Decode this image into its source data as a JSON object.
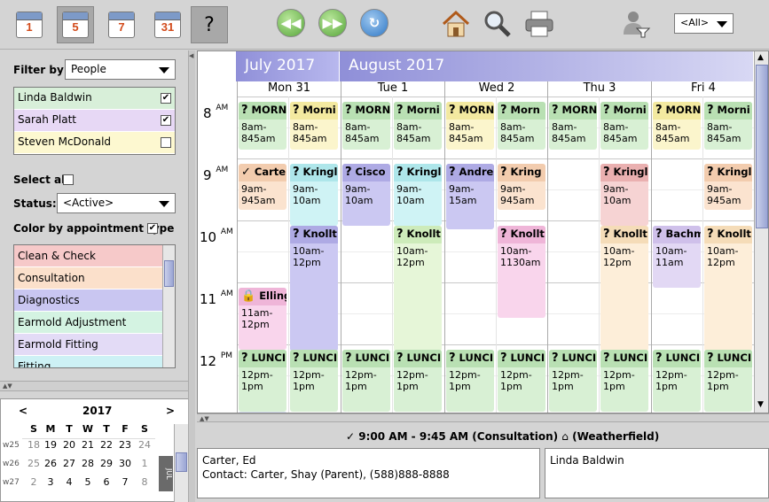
{
  "toolbar": {
    "day_view_number": "1",
    "work_week_number": "5",
    "week_number": "7",
    "month_number": "31",
    "help_label": "?",
    "provider_filter": "<All>"
  },
  "filter": {
    "filter_by_label": "Filter by:",
    "filter_by_value": "People",
    "people": [
      {
        "name": "Linda Baldwin",
        "checked": true,
        "color": "#d8efd9"
      },
      {
        "name": "Sarah Platt",
        "checked": true,
        "color": "#e7d8f5"
      },
      {
        "name": "Steven McDonald",
        "checked": false,
        "color": "#fdf8d0"
      }
    ],
    "select_all_label": "Select all",
    "status_label": "Status:",
    "status_value": "<Active>",
    "color_by_type_label": "Color by appointment type",
    "appointment_types": [
      {
        "name": "Clean & Check",
        "color": "#f6c9c9"
      },
      {
        "name": "Consultation",
        "color": "#fbe0cb"
      },
      {
        "name": "Diagnostics",
        "color": "#c9c6f1"
      },
      {
        "name": "Earmold Adjustment",
        "color": "#d4f3e2"
      },
      {
        "name": "Earmold Fitting",
        "color": "#e3dbf6"
      },
      {
        "name": "Fitting",
        "color": "#cdf1f5"
      }
    ]
  },
  "minical": {
    "prev": "<",
    "year": "2017",
    "next": ">",
    "weekdays": [
      "S",
      "M",
      "T",
      "W",
      "T",
      "F",
      "S"
    ],
    "weeks": [
      {
        "label": "w25",
        "days": [
          "18",
          "19",
          "20",
          "21",
          "22",
          "23",
          "24"
        ]
      },
      {
        "label": "w26",
        "days": [
          "25",
          "26",
          "27",
          "28",
          "29",
          "30",
          "1"
        ]
      },
      {
        "label": "w27",
        "days": [
          "2",
          "3",
          "4",
          "5",
          "6",
          "7",
          "8"
        ]
      }
    ],
    "side_month": "JUL"
  },
  "calendar": {
    "months": [
      "July 2017",
      "August 2017"
    ],
    "days": [
      "Mon 31",
      "Tue 1",
      "Wed 2",
      "Thu 3",
      "Fri 4"
    ],
    "hours": [
      {
        "h": "8",
        "ap": "AM"
      },
      {
        "h": "9",
        "ap": "AM"
      },
      {
        "h": "10",
        "ap": "AM"
      },
      {
        "h": "11",
        "ap": "AM"
      },
      {
        "h": "12",
        "ap": "PM"
      }
    ],
    "appointments": [
      {
        "title": "MORN",
        "icon": "?",
        "time": "8am-845am"
      },
      {
        "title": "Morni",
        "icon": "?",
        "time": "8am-845am"
      },
      {
        "title": "MORN",
        "icon": "?",
        "time": "8am-845am"
      },
      {
        "title": "Morni",
        "icon": "?",
        "time": "8am-845am"
      },
      {
        "title": "MORN",
        "icon": "?",
        "time": "8am-845am"
      },
      {
        "title": "Morn",
        "icon": "?",
        "time": "8am-845am"
      },
      {
        "title": "MORN",
        "icon": "?",
        "time": "8am-845am"
      },
      {
        "title": "Morni",
        "icon": "?",
        "time": "8am-845am"
      },
      {
        "title": "MORN",
        "icon": "?",
        "time": "8am-845am"
      },
      {
        "title": "Morni",
        "icon": "?",
        "time": "8am-845am"
      },
      {
        "title": "Carte",
        "icon": "✓",
        "time": "9am-945am"
      },
      {
        "title": "Kringl",
        "icon": "?",
        "time": "9am-10am"
      },
      {
        "title": "Cisco",
        "icon": "?",
        "time": "9am-10am"
      },
      {
        "title": "Kringl",
        "icon": "?",
        "time": "9am-10am"
      },
      {
        "title": "Andre",
        "icon": "?",
        "time": "9am-15am"
      },
      {
        "title": "Kring",
        "icon": "?",
        "time": "9am-945am"
      },
      {
        "title": "Kringl",
        "icon": "?",
        "time": "9am-10am"
      },
      {
        "title": "Kringl",
        "icon": "?",
        "time": "9am-945am"
      },
      {
        "title": "Knollt",
        "icon": "?",
        "time": "10am-12pm"
      },
      {
        "title": "Knollt",
        "icon": "?",
        "time": "10am-12pm"
      },
      {
        "title": "Knollt",
        "icon": "?",
        "time": "10am-1130am"
      },
      {
        "title": "Knollt",
        "icon": "?",
        "time": "10am-12pm"
      },
      {
        "title": "Bachm",
        "icon": "?",
        "time": "10am-11am"
      },
      {
        "title": "Knollt",
        "icon": "?",
        "time": "10am-12pm"
      },
      {
        "title": "Ellings",
        "icon": "lock",
        "time": "11am-12pm"
      },
      {
        "title": "LUNCI",
        "icon": "?",
        "time": "12pm-1pm"
      },
      {
        "title": "LUNCI",
        "icon": "?",
        "time": "12pm-1pm"
      },
      {
        "title": "LUNCI",
        "icon": "?",
        "time": "12pm-1pm"
      },
      {
        "title": "LUNCI",
        "icon": "?",
        "time": "12pm-1pm"
      },
      {
        "title": "LUNCI",
        "icon": "?",
        "time": "12pm-1pm"
      },
      {
        "title": "LUNCI",
        "icon": "?",
        "time": "12pm-1pm"
      },
      {
        "title": "LUNCI",
        "icon": "?",
        "time": "12pm-1pm"
      },
      {
        "title": "LUNCI",
        "icon": "?",
        "time": "12pm-1pm"
      },
      {
        "title": "LUNCI",
        "icon": "?",
        "time": "12pm-1pm"
      },
      {
        "title": "LUNCI",
        "icon": "?",
        "time": "12pm-1pm"
      },
      {
        "title": "LUNCI",
        "icon": "?",
        "time": "12pm-1pm"
      }
    ]
  },
  "details": {
    "status_icon": "✓",
    "summary_time": "9:00 AM - 9:45 AM (Consultation)",
    "location": "(Weatherfield)",
    "patient_name": "Carter, Ed",
    "contact": "Contact:  Carter, Shay (Parent), (588)888-8888",
    "provider": "Linda Baldwin"
  }
}
